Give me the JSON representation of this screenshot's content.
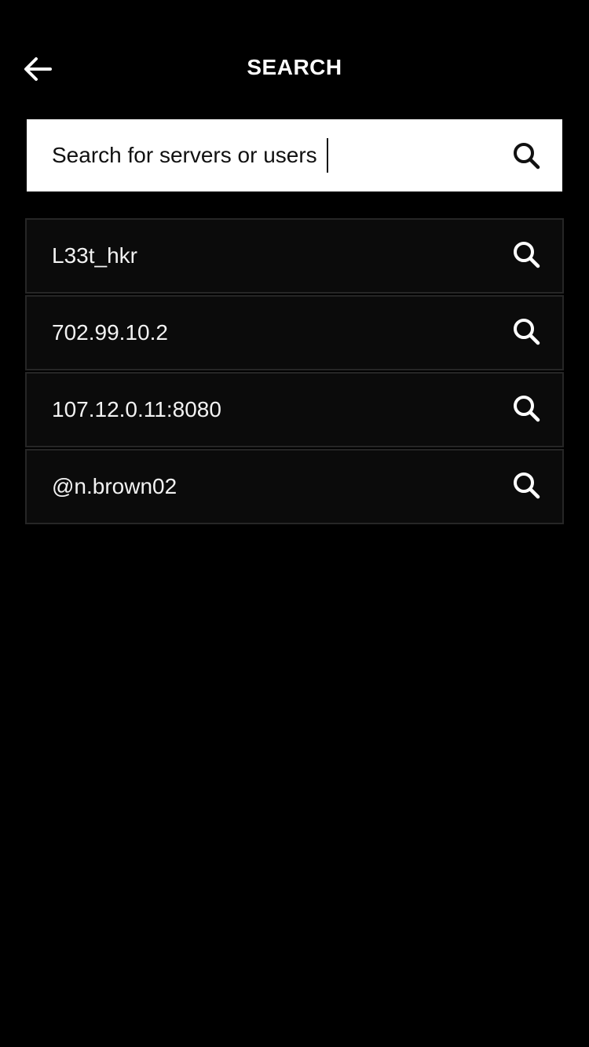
{
  "header": {
    "title": "SEARCH",
    "back_icon": "arrow-left-icon"
  },
  "search": {
    "placeholder": "Search for servers or users",
    "value": "",
    "submit_icon": "search-icon"
  },
  "results": [
    {
      "label": "L33t_hkr",
      "icon": "search-icon"
    },
    {
      "label": "702.99.10.2",
      "icon": "search-icon"
    },
    {
      "label": "107.12.0.11:8080",
      "icon": "search-icon"
    },
    {
      "label": "@n.brown02",
      "icon": "search-icon"
    }
  ],
  "colors": {
    "background": "#000000",
    "search_box": "#ffffff",
    "row_background": "#0b0b0b",
    "row_border": "#262626",
    "text_light": "#ffffff",
    "text_dark": "#111111"
  }
}
